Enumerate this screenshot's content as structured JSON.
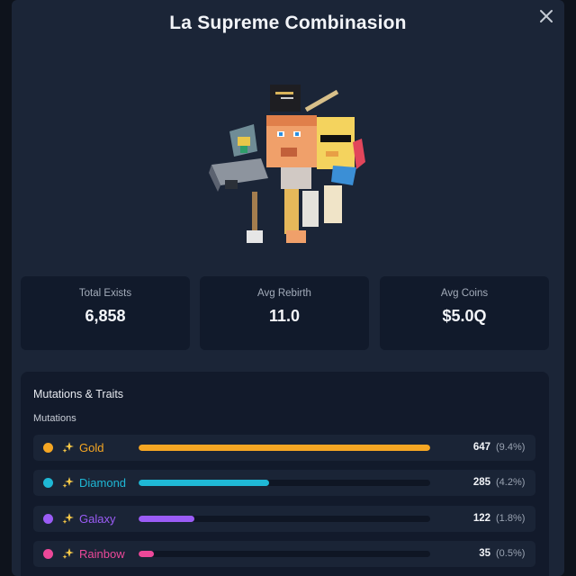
{
  "title": "La Supreme Combinasion",
  "stats": [
    {
      "label": "Total Exists",
      "value": "6,858"
    },
    {
      "label": "Avg Rebirth",
      "value": "11.0"
    },
    {
      "label": "Avg Coins",
      "value": "$5.0Q"
    }
  ],
  "section": {
    "title": "Mutations & Traits",
    "subtitle": "Mutations"
  },
  "mutations": [
    {
      "name": "Gold",
      "count": "647",
      "pct": "(9.4%)",
      "share": 0.094,
      "color": "#f5a623"
    },
    {
      "name": "Diamond",
      "count": "285",
      "pct": "(4.2%)",
      "share": 0.042,
      "color": "#1fb8d6"
    },
    {
      "name": "Galaxy",
      "count": "122",
      "pct": "(1.8%)",
      "share": 0.018,
      "color": "#9b5cf6"
    },
    {
      "name": "Rainbow",
      "count": "35",
      "pct": "(0.5%)",
      "share": 0.005,
      "color": "#ec4899"
    }
  ],
  "icons": {
    "close": "close-icon",
    "sparkle": "sparkles-icon",
    "hero": "character-render"
  },
  "colors": {
    "panel": "#1b2537",
    "card": "#111a2b",
    "accent_gold": "#f5a623"
  }
}
